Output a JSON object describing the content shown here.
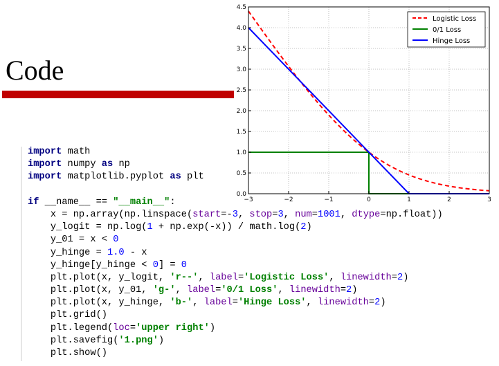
{
  "slide": {
    "title": "Code",
    "accent_color": "#c00000"
  },
  "code_lines": [
    [
      [
        "import",
        "kw"
      ],
      [
        " math",
        "plain"
      ]
    ],
    [
      [
        "import",
        "kw"
      ],
      [
        " numpy ",
        "plain"
      ],
      [
        "as",
        "kw"
      ],
      [
        " np",
        "plain"
      ]
    ],
    [
      [
        "import",
        "kw"
      ],
      [
        " matplotlib.pyplot ",
        "plain"
      ],
      [
        "as",
        "kw"
      ],
      [
        " plt",
        "plain"
      ]
    ],
    [],
    [
      [
        "if",
        "kw"
      ],
      [
        " __name__ == ",
        "plain"
      ],
      [
        "\"__main__\"",
        "str"
      ],
      [
        ":",
        "plain"
      ]
    ],
    [
      [
        "    x = np.array(np.linspace(",
        "plain"
      ],
      [
        "start",
        "param"
      ],
      [
        "=-",
        "plain"
      ],
      [
        "3",
        "num"
      ],
      [
        ", ",
        "plain"
      ],
      [
        "stop",
        "param"
      ],
      [
        "=",
        "plain"
      ],
      [
        "3",
        "num"
      ],
      [
        ", ",
        "plain"
      ],
      [
        "num",
        "param"
      ],
      [
        "=",
        "plain"
      ],
      [
        "1001",
        "num"
      ],
      [
        ", ",
        "plain"
      ],
      [
        "dtype",
        "param"
      ],
      [
        "=np.float))",
        "plain"
      ]
    ],
    [
      [
        "    y_logit = np.log(",
        "plain"
      ],
      [
        "1",
        "num"
      ],
      [
        " + np.exp(-x)) / math.log(",
        "plain"
      ],
      [
        "2",
        "num"
      ],
      [
        ")",
        "plain"
      ]
    ],
    [
      [
        "    y_01 = x < ",
        "plain"
      ],
      [
        "0",
        "num"
      ]
    ],
    [
      [
        "    y_hinge = ",
        "plain"
      ],
      [
        "1.0",
        "num"
      ],
      [
        " - x",
        "plain"
      ]
    ],
    [
      [
        "    y_hinge[y_hinge < ",
        "plain"
      ],
      [
        "0",
        "num"
      ],
      [
        "] = ",
        "plain"
      ],
      [
        "0",
        "num"
      ]
    ],
    [
      [
        "    plt.plot(x, y_logit, ",
        "plain"
      ],
      [
        "'r--'",
        "str"
      ],
      [
        ", ",
        "plain"
      ],
      [
        "label",
        "param"
      ],
      [
        "=",
        "plain"
      ],
      [
        "'Logistic Loss'",
        "str"
      ],
      [
        ", ",
        "plain"
      ],
      [
        "linewidth",
        "param"
      ],
      [
        "=",
        "plain"
      ],
      [
        "2",
        "num"
      ],
      [
        ")",
        "plain"
      ]
    ],
    [
      [
        "    plt.plot(x, y_01, ",
        "plain"
      ],
      [
        "'g-'",
        "str"
      ],
      [
        ", ",
        "plain"
      ],
      [
        "label",
        "param"
      ],
      [
        "=",
        "plain"
      ],
      [
        "'0/1 Loss'",
        "str"
      ],
      [
        ", ",
        "plain"
      ],
      [
        "linewidth",
        "param"
      ],
      [
        "=",
        "plain"
      ],
      [
        "2",
        "num"
      ],
      [
        ")",
        "plain"
      ]
    ],
    [
      [
        "    plt.plot(x, y_hinge, ",
        "plain"
      ],
      [
        "'b-'",
        "str"
      ],
      [
        ", ",
        "plain"
      ],
      [
        "label",
        "param"
      ],
      [
        "=",
        "plain"
      ],
      [
        "'Hinge Loss'",
        "str"
      ],
      [
        ", ",
        "plain"
      ],
      [
        "linewidth",
        "param"
      ],
      [
        "=",
        "plain"
      ],
      [
        "2",
        "num"
      ],
      [
        ")",
        "plain"
      ]
    ],
    [
      [
        "    plt.grid()",
        "plain"
      ]
    ],
    [
      [
        "    plt.legend(",
        "plain"
      ],
      [
        "loc",
        "param"
      ],
      [
        "=",
        "plain"
      ],
      [
        "'upper right'",
        "str"
      ],
      [
        ")",
        "plain"
      ]
    ],
    [
      [
        "    plt.savefig(",
        "plain"
      ],
      [
        "'1.png'",
        "str"
      ],
      [
        ")",
        "plain"
      ]
    ],
    [
      [
        "    plt.show()",
        "plain"
      ]
    ]
  ],
  "chart_data": {
    "type": "line",
    "xlim": [
      -3,
      3
    ],
    "ylim": [
      0,
      4.5
    ],
    "xticks": [
      "−3",
      "−2",
      "−1",
      "0",
      "1",
      "2",
      "3"
    ],
    "xtick_values": [
      -3,
      -2,
      -1,
      0,
      1,
      2,
      3
    ],
    "yticks": [
      "0.0",
      "0.5",
      "1.0",
      "1.5",
      "2.0",
      "2.5",
      "3.0",
      "3.5",
      "4.0",
      "4.5"
    ],
    "ytick_values": [
      0,
      0.5,
      1,
      1.5,
      2,
      2.5,
      3,
      3.5,
      4,
      4.5
    ],
    "grid": true,
    "legend_position": "top-right",
    "series": [
      {
        "name": "Logistic Loss",
        "color": "#ff0000",
        "style": "dashed",
        "x": [
          -3,
          -2.5,
          -2,
          -1.5,
          -1,
          -0.5,
          0,
          0.5,
          1,
          1.5,
          2,
          2.5,
          3
        ],
        "y": [
          4.398,
          3.721,
          3.069,
          2.455,
          1.895,
          1.405,
          1.0,
          0.684,
          0.452,
          0.291,
          0.183,
          0.114,
          0.07
        ]
      },
      {
        "name": "0/1 Loss",
        "color": "#008000",
        "style": "solid",
        "x": [
          -3,
          0,
          0,
          3
        ],
        "y": [
          1,
          1,
          0,
          0
        ]
      },
      {
        "name": "Hinge Loss",
        "color": "#0000ff",
        "style": "solid",
        "x": [
          -3,
          1,
          3
        ],
        "y": [
          4,
          0,
          0
        ]
      }
    ]
  }
}
